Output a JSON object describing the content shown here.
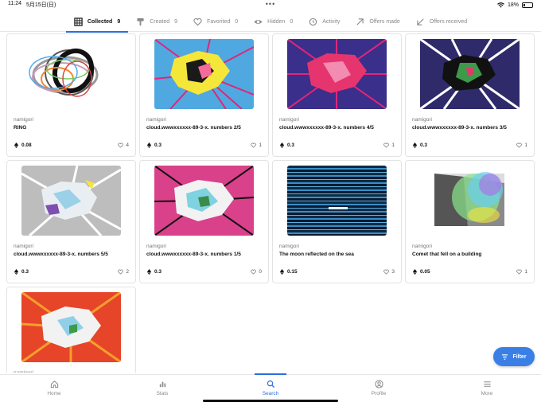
{
  "status": {
    "time": "11:24",
    "date": "5月15日(日)",
    "dots": "•••",
    "battery": "18%"
  },
  "tabs": [
    {
      "label": "Collected",
      "count": "9",
      "icon": "grid-icon"
    },
    {
      "label": "Created",
      "count": "9",
      "icon": "brush-icon"
    },
    {
      "label": "Favorited",
      "count": "0",
      "icon": "heart-icon"
    },
    {
      "label": "Hidden",
      "count": "0",
      "icon": "eye-icon"
    },
    {
      "label": "Activity",
      "count": "",
      "icon": "history-icon"
    },
    {
      "label": "Offers made",
      "count": "",
      "icon": "arrow-up-right-icon"
    },
    {
      "label": "Offers received",
      "count": "",
      "icon": "arrow-down-left-icon"
    }
  ],
  "cards": [
    {
      "owner": "namigori",
      "title": "RING",
      "price": "0.08",
      "likes": "4",
      "art": "ring"
    },
    {
      "owner": "namigori",
      "title": "cloud.wwwxxxxxx-89-3-x. numbers 2/5",
      "price": "0.3",
      "likes": "1",
      "art": "burst-blue"
    },
    {
      "owner": "namigori",
      "title": "cloud.wwwxxxxxx-89-3-x. numbers 4/5",
      "price": "0.3",
      "likes": "1",
      "art": "burst-purple"
    },
    {
      "owner": "namigori",
      "title": "cloud.wwwxxxxxx-89-3-x. numbers 3/5",
      "price": "0.3",
      "likes": "1",
      "art": "burst-dark"
    },
    {
      "owner": "namigori",
      "title": "cloud.wwwxxxxxx-89-3-x. numbers 5/5",
      "price": "0.3",
      "likes": "2",
      "art": "burst-grey"
    },
    {
      "owner": "namigori",
      "title": "cloud.wwwxxxxxx-89-3-x. numbers 1/5",
      "price": "0.3",
      "likes": "0",
      "art": "burst-pink"
    },
    {
      "owner": "namigori",
      "title": "The moon reflected on the sea",
      "price": "0.15",
      "likes": "3",
      "art": "stripes"
    },
    {
      "owner": "namigori",
      "title": "Comet that fell on a building",
      "price": "0.05",
      "likes": "1",
      "art": "comet"
    },
    {
      "owner": "namigori",
      "title": "",
      "price": "",
      "likes": "",
      "art": "burst-red"
    }
  ],
  "filter": {
    "label": "Filter"
  },
  "nav": [
    {
      "label": "Home",
      "icon": "home-icon"
    },
    {
      "label": "Stats",
      "icon": "bar-chart-icon"
    },
    {
      "label": "Search",
      "icon": "search-icon"
    },
    {
      "label": "Profile",
      "icon": "profile-icon"
    },
    {
      "label": "More",
      "icon": "menu-icon"
    }
  ],
  "colors": {
    "accent": "#2a6fdb",
    "filter_button": "#3a7fe6"
  }
}
